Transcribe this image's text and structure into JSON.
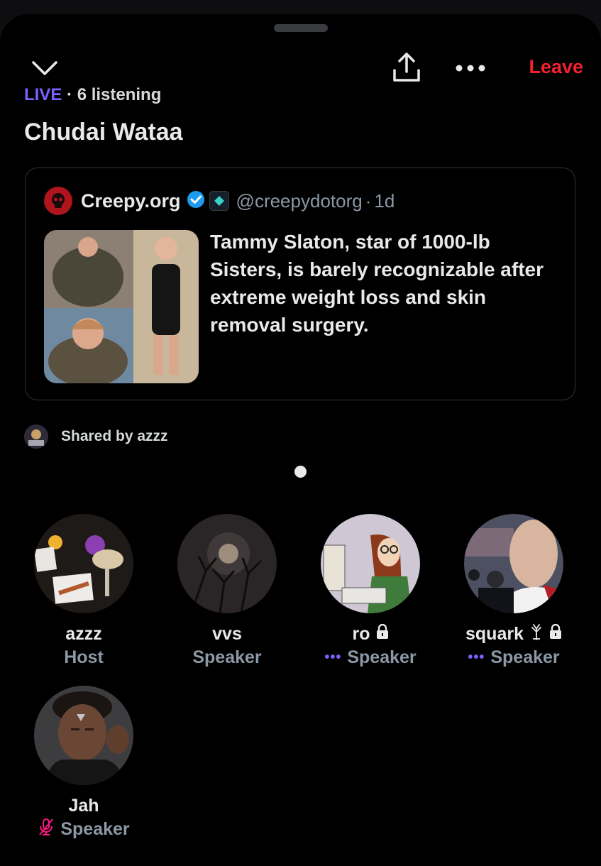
{
  "header": {
    "leave_label": "Leave",
    "icons": {
      "collapse": "chevron-down-icon",
      "share": "share-icon",
      "more": "more-icon"
    }
  },
  "space": {
    "live_label": "LIVE",
    "listeners": "6 listening",
    "title": "Chudai Wataa"
  },
  "tweet": {
    "author": "Creepy.org",
    "handle": "@creepydotorg",
    "age": "1d",
    "text": "Tammy Slaton, star of 1000-lb Sisters, is barely recognizable after extreme weight loss and skin removal surgery."
  },
  "shared_by": "Shared by azzz",
  "participants": [
    {
      "name": "azzz",
      "role": "Host"
    },
    {
      "name": "vvs",
      "role": "Speaker"
    },
    {
      "name": "ro",
      "role": "Speaker"
    },
    {
      "name": "squark",
      "role": "Speaker"
    },
    {
      "name": "Jah",
      "role": "Speaker"
    }
  ],
  "colors": {
    "accent": "#7b61ff",
    "danger": "#f4212e",
    "muted": "#8b98a5",
    "background": "#000000"
  }
}
